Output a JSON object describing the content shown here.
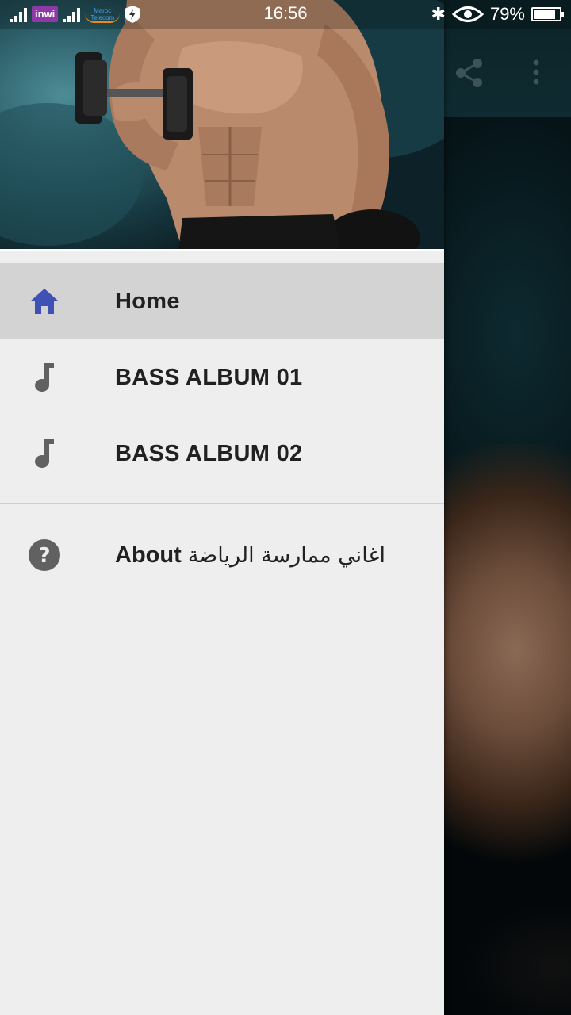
{
  "status_bar": {
    "carrier_1": "inwi",
    "carrier_2_line1": "Maroc",
    "carrier_2_line2": "Telecom",
    "time": "16:56",
    "battery_percent": "79%",
    "battery_level": 0.79
  },
  "app_bar": {
    "icons": [
      "share-icon",
      "more-vert-icon"
    ]
  },
  "drawer": {
    "header_image": "fitness-man-with-dumbbell",
    "items": [
      {
        "label": "Home",
        "icon": "home-icon",
        "selected": true
      },
      {
        "label": "BASS ALBUM 01",
        "icon": "music-note-icon",
        "selected": false
      },
      {
        "label": "BASS ALBUM 02",
        "icon": "music-note-icon",
        "selected": false
      }
    ],
    "about": {
      "label_en": "About",
      "label_ar": "اغاني ممارسة الرياضة",
      "icon": "help-icon"
    }
  },
  "colors": {
    "drawer_bg": "#eeeeee",
    "selected_bg": "#d3d3d3",
    "home_icon": "#3f51b5",
    "icon_grey": "#616161",
    "text": "#212121"
  }
}
